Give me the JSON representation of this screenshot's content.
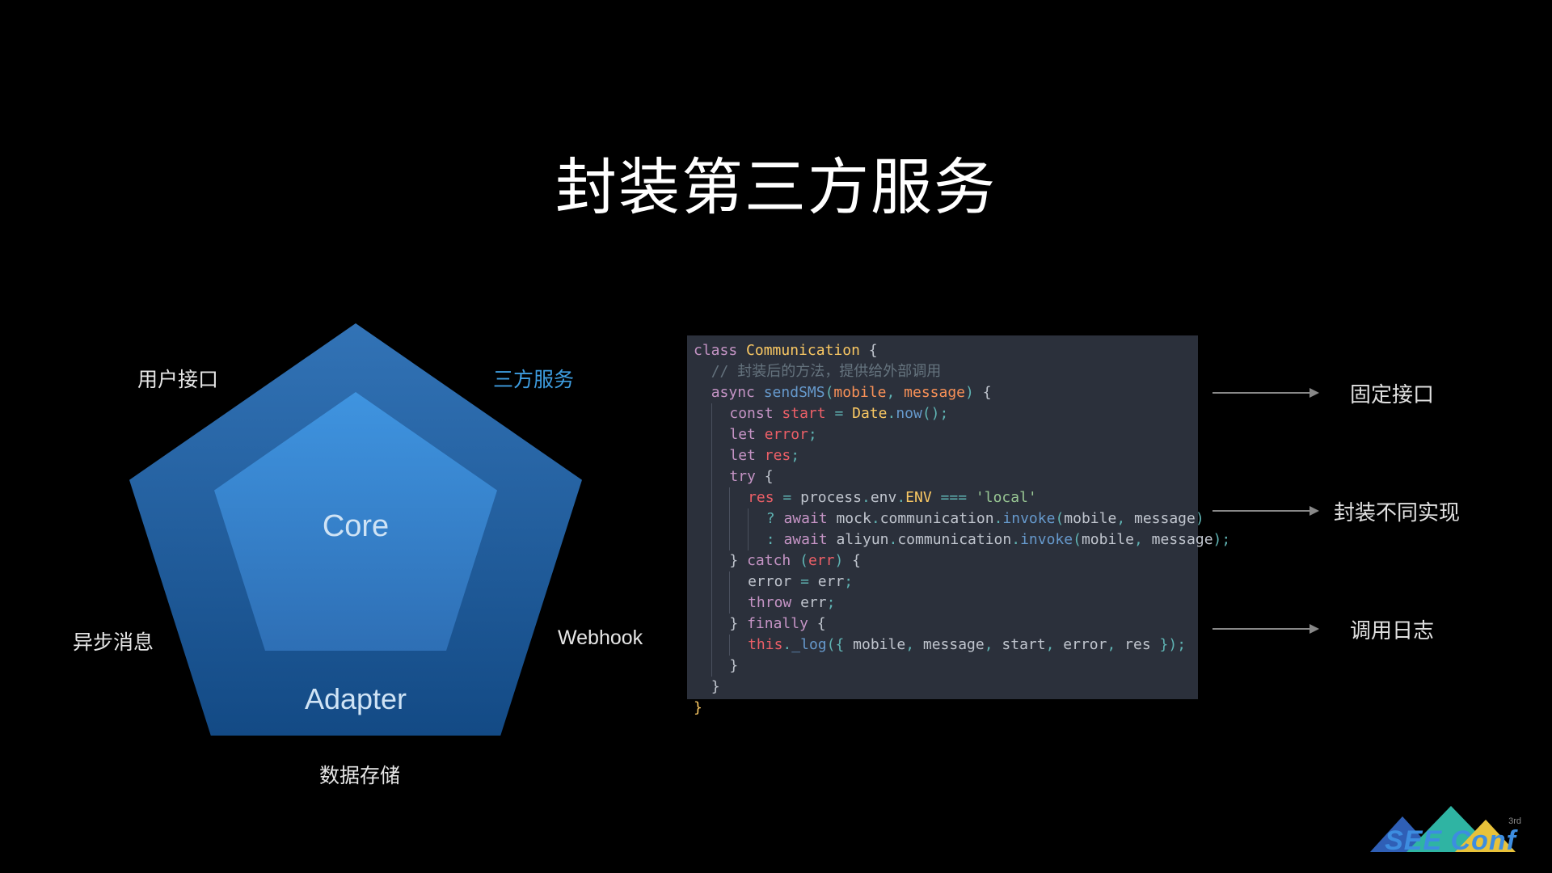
{
  "title": "封装第三方服务",
  "pentagon": {
    "core": "Core",
    "adapter": "Adapter",
    "labels": {
      "top_left": "用户接口",
      "top_right": "三方服务",
      "mid_left": "异步消息",
      "mid_right": "Webhook",
      "bottom": "数据存储"
    }
  },
  "code": {
    "l1_class": "class",
    "l1_name": "Communication",
    "l2_comment": "// 封装后的方法，提供给外部调用",
    "l3_async": "async",
    "l3_fn": "sendSMS",
    "l3_p1": "mobile",
    "l3_p2": "message",
    "l4_const": "const",
    "l4_var": "start",
    "l4_date": "Date",
    "l4_now": "now",
    "l5_let": "let",
    "l5_var": "error",
    "l6_let": "let",
    "l6_var": "res",
    "l7_try": "try",
    "l8_res": "res",
    "l8_proc": "process",
    "l8_env": "env",
    "l8_ENV": "ENV",
    "l8_eq": "===",
    "l8_str": "'local'",
    "l9_await": "await",
    "l9_mock": "mock",
    "l9_comm": "communication",
    "l9_invoke": "invoke",
    "l9_p1": "mobile",
    "l9_p2": "message",
    "l10_await": "await",
    "l10_ali": "aliyun",
    "l10_comm": "communication",
    "l10_invoke": "invoke",
    "l10_p1": "mobile",
    "l10_p2": "message",
    "l11_catch": "catch",
    "l11_err": "err",
    "l12_error": "error",
    "l12_err": "err",
    "l13_throw": "throw",
    "l13_err": "err",
    "l14_finally": "finally",
    "l15_this": "this",
    "l15_log": "_log",
    "l15_mobile": "mobile",
    "l15_message": "message",
    "l15_start": "start",
    "l15_error": "error",
    "l15_res": "res"
  },
  "annotations": {
    "a1": "固定接口",
    "a2": "封装不同实现",
    "a3": "调用日志"
  },
  "logo": {
    "text": "SEE Conf",
    "small": "3rd"
  }
}
